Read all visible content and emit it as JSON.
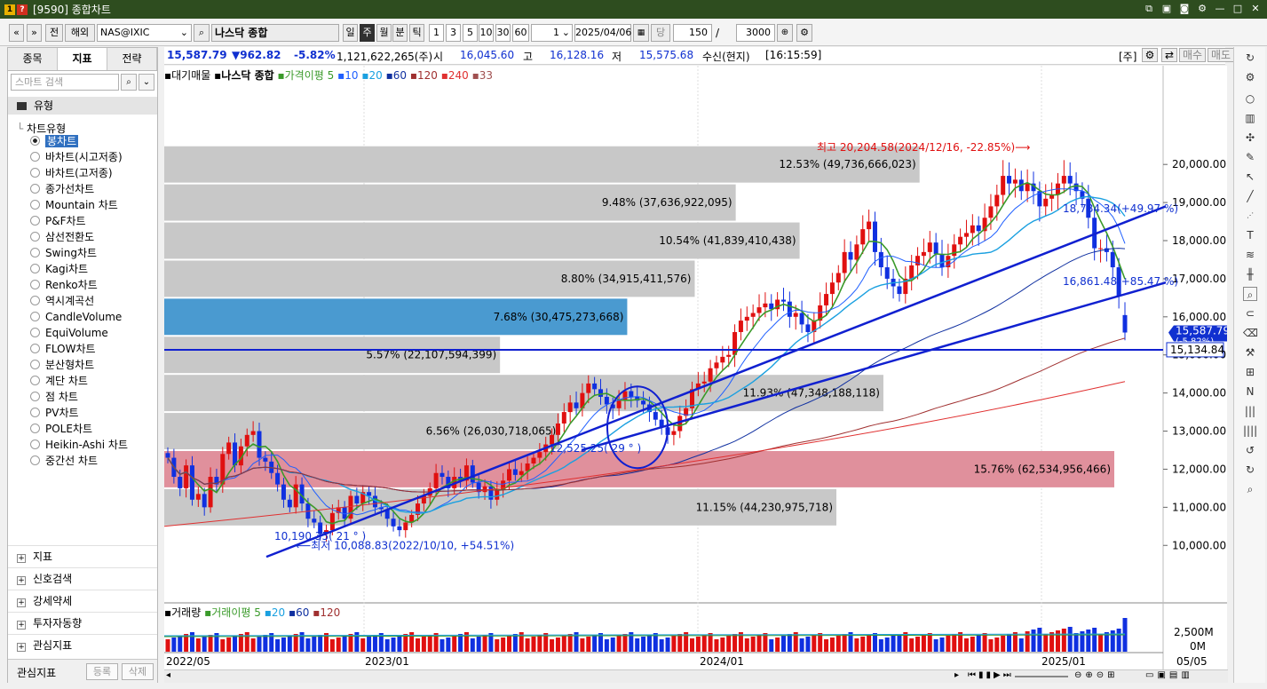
{
  "window": {
    "title": "[9590] 종합차트",
    "logo_a": "1",
    "logo_b": "?"
  },
  "toolbar": {
    "nav_prev": "«",
    "nav_dropdown": "»",
    "market_domestic": "전",
    "market_overseas": "해외",
    "symbol_code": "NAS@IXIC",
    "symbol_name": "나스닥 종합",
    "periods": [
      "일",
      "주",
      "월",
      "분",
      "틱"
    ],
    "active_period": "주",
    "intervals": [
      "1",
      "3",
      "5",
      "10",
      "30",
      "60"
    ],
    "unit_value": "1",
    "date": "2025/04/06",
    "date_label": "당",
    "count": "150",
    "total": "3000"
  },
  "left_panel": {
    "tabs": [
      "종목",
      "지표",
      "전략"
    ],
    "active_tab": "지표",
    "search_placeholder": "스마트 검색",
    "section_label": "유형",
    "group_label": "차트유형",
    "chart_types": [
      "봉차트",
      "바차트(시고저종)",
      "바차트(고저종)",
      "종가선차트",
      "Mountain 차트",
      "P&F차트",
      "삼선전환도",
      "Swing차트",
      "Kagi차트",
      "Renko차트",
      "역시계곡선",
      "CandleVolume",
      "EquiVolume",
      "FLOW차트",
      "분산형차트",
      "계단 차트",
      "점 차트",
      "PV차트",
      "POLE차트",
      "Heikin-Ashi 차트",
      "중간선 차트"
    ],
    "selected_type": "봉차트",
    "bottom_groups": [
      "지표",
      "신호검색",
      "강세약세",
      "투자자동향",
      "관심지표"
    ],
    "footer": {
      "label": "관심지표",
      "register": "등록",
      "delete": "삭제"
    }
  },
  "infobar": {
    "last": "15,587.79",
    "change": "▼962.82",
    "change_pct": "-5.82%",
    "volume": "1,121,622,265(주)",
    "open_label": "시",
    "open": "16,045.60",
    "high_label": "고",
    "high": "16,128.16",
    "low_label": "저",
    "low": "15,575.68",
    "mode": "수신(현지)",
    "time": "[16:15:59]",
    "unit_btn": "[주]",
    "buy_btn": "매수",
    "sell_btn": "매도"
  },
  "legend": {
    "vp": "대기매물",
    "name": "나스닥 종합",
    "ma_label": "가격이평",
    "ma_periods": [
      "5",
      "10",
      "20",
      "60",
      "120",
      "240",
      "33"
    ],
    "ma_colors": [
      "#3a9a2a",
      "#2060ff",
      "#1aa0e0",
      "#1030a0",
      "#a03030",
      "#e03030",
      "#a05050"
    ]
  },
  "volume_legend": {
    "name": "거래량",
    "ma_label": "거래이평",
    "periods": [
      "5",
      "20",
      "60",
      "120"
    ]
  },
  "annotations": {
    "high": "최고 20,204.58(2024/12/16, -22.85%)⟶",
    "low": "⟵최저 10,088.83(2022/10/10, +54.51%)",
    "angle1": "10,190.35( 21 ° )",
    "angle2": "12,525.25( 29 ° )",
    "trend1": "18,784.34(+49.97 %)",
    "trend2": "16,861.48(+85.47 %)",
    "hline_value": "15,134.84",
    "last_price": "15,587.79",
    "last_pct": "(-5.82%)"
  },
  "volume_profile": [
    {
      "label": "12.53% (49,736,666,023)",
      "pct": 12.53,
      "lo": 19500,
      "hi": 20500
    },
    {
      "label": "9.48% (37,636,922,095)",
      "pct": 9.48,
      "lo": 18500,
      "hi": 19500
    },
    {
      "label": "10.54% (41,839,410,438)",
      "pct": 10.54,
      "lo": 17500,
      "hi": 18500
    },
    {
      "label": "8.80% (34,915,411,576)",
      "pct": 8.8,
      "lo": 16500,
      "hi": 17500
    },
    {
      "label": "7.68% (30,475,273,668)",
      "pct": 7.68,
      "lo": 15500,
      "hi": 16500,
      "highlight": "blue"
    },
    {
      "label": "5.57% (22,107,594,399)",
      "pct": 5.57,
      "lo": 14500,
      "hi": 15500
    },
    {
      "label": "11.93% (47,348,188,118)",
      "pct": 11.93,
      "lo": 13500,
      "hi": 14500
    },
    {
      "label": "6.56% (26,030,718,065)",
      "pct": 6.56,
      "lo": 12500,
      "hi": 13500
    },
    {
      "label": "15.76% (62,534,956,466)",
      "pct": 15.76,
      "lo": 11500,
      "hi": 12500,
      "highlight": "red"
    },
    {
      "label": "11.15% (44,230,975,718)",
      "pct": 11.15,
      "lo": 10500,
      "hi": 11500
    }
  ],
  "chart_data": {
    "type": "candlestick",
    "title": "나스닥 종합",
    "x_ticks": [
      "2022/05",
      "2023/01",
      "2024/01",
      "2025/01",
      "05/05"
    ],
    "y_ticks": [
      "20,000.00",
      "19,000.00",
      "18,000.00",
      "17,000.00",
      "16,000.00",
      "15,000.00",
      "14,000.00",
      "13,000.00",
      "12,000.00",
      "11,000.00",
      "10,000.00"
    ],
    "ylim": [
      9400,
      21100
    ],
    "volume_ticks": [
      "2,500M",
      "0M"
    ],
    "series_close_weekly": [
      12300,
      11800,
      11500,
      12100,
      11200,
      11350,
      11000,
      11800,
      11600,
      12400,
      12700,
      12100,
      12600,
      12900,
      13000,
      12300,
      12200,
      11900,
      11600,
      11200,
      11000,
      11600,
      11100,
      10700,
      10600,
      10300,
      10400,
      10850,
      11000,
      10700,
      11300,
      11100,
      11400,
      11300,
      11000,
      10950,
      10700,
      10500,
      10400,
      10600,
      10800,
      11100,
      11300,
      11500,
      11900,
      11800,
      11500,
      11800,
      11700,
      12100,
      11650,
      11400,
      11550,
      11200,
      11450,
      11700,
      12000,
      11850,
      11950,
      12150,
      12300,
      12450,
      12650,
      12900,
      13200,
      13500,
      13750,
      13600,
      14000,
      14250,
      14100,
      13900,
      13700,
      13600,
      13800,
      14050,
      13900,
      13800,
      13700,
      13500,
      13300,
      13100,
      12900,
      13000,
      13400,
      13600,
      14100,
      14250,
      14300,
      14650,
      14800,
      14950,
      15000,
      15600,
      15900,
      16000,
      16100,
      16250,
      16350,
      16200,
      16450,
      16400,
      16000,
      16100,
      15800,
      15600,
      15900,
      16300,
      16600,
      16900,
      17150,
      17700,
      17500,
      17900,
      18300,
      18500,
      17700,
      17300,
      17000,
      16800,
      16600,
      17000,
      17350,
      17600,
      17700,
      17950,
      17650,
      17300,
      17600,
      17900,
      18100,
      18200,
      18400,
      18250,
      18600,
      18900,
      19200,
      19700,
      19500,
      19600,
      19300,
      19500,
      19300,
      18900,
      19100,
      19200,
      19500,
      19700,
      19500,
      19300,
      19100,
      18600,
      17800,
      17800,
      17700,
      17300,
      16550,
      15588
    ]
  }
}
